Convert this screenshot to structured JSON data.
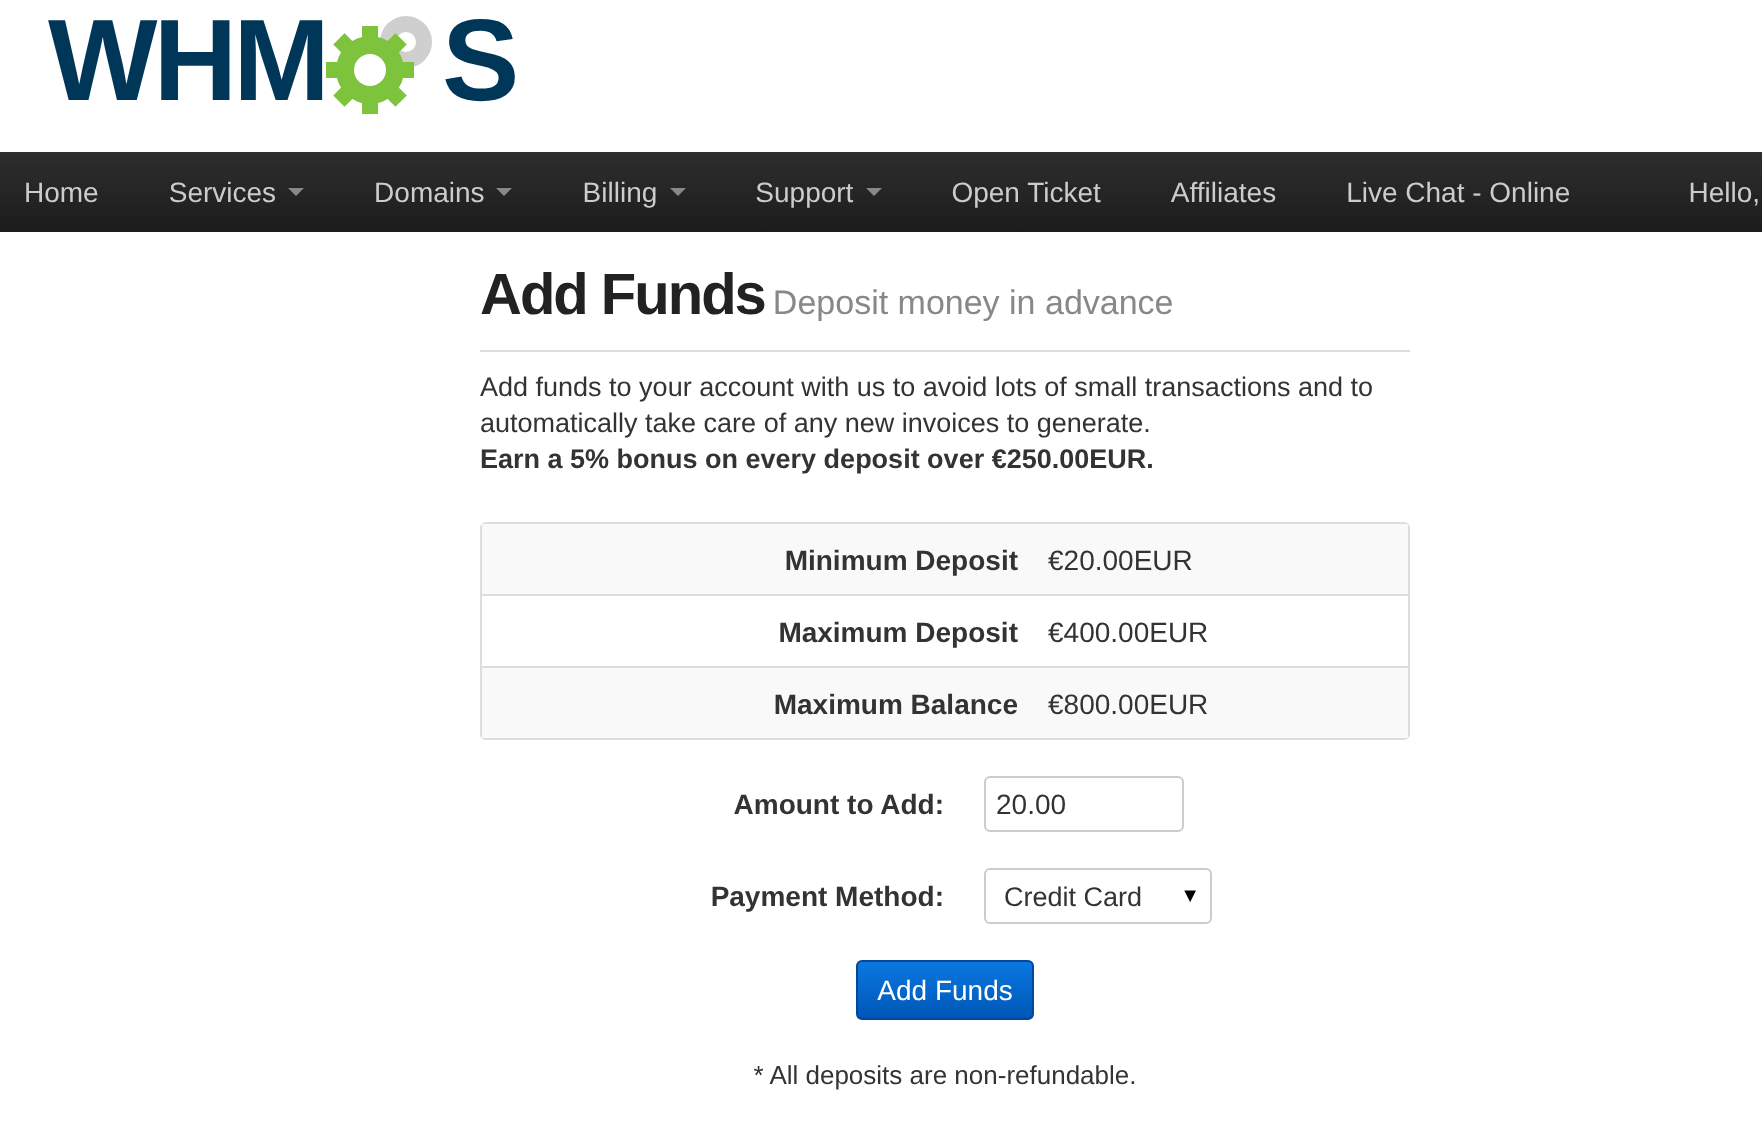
{
  "logo": {
    "left": "WHM",
    "right": "S"
  },
  "nav": {
    "items": [
      {
        "label": "Home",
        "dropdown": false
      },
      {
        "label": "Services",
        "dropdown": true
      },
      {
        "label": "Domains",
        "dropdown": true
      },
      {
        "label": "Billing",
        "dropdown": true
      },
      {
        "label": "Support",
        "dropdown": true
      },
      {
        "label": "Open Ticket",
        "dropdown": false
      },
      {
        "label": "Affiliates",
        "dropdown": false
      },
      {
        "label": "Live Chat - Online",
        "dropdown": false
      }
    ],
    "greeting": "Hello,"
  },
  "page": {
    "title": "Add Funds",
    "subtitle": "Deposit money in advance",
    "intro": "Add funds to your account with us to avoid lots of small transactions and to automatically take care of any new invoices to generate.",
    "bonus": "Earn a 5% bonus on every deposit over €250.00EUR."
  },
  "limits": [
    {
      "label": "Minimum Deposit",
      "value": "€20.00EUR"
    },
    {
      "label": "Maximum Deposit",
      "value": "€400.00EUR"
    },
    {
      "label": "Maximum Balance",
      "value": "€800.00EUR"
    }
  ],
  "form": {
    "amount": {
      "label": "Amount to Add:",
      "value": "20.00"
    },
    "payment": {
      "label": "Payment Method:",
      "value": "Credit Card",
      "caret": "▼"
    },
    "submit": "Add Funds"
  },
  "note": "* All deposits are non-refundable."
}
